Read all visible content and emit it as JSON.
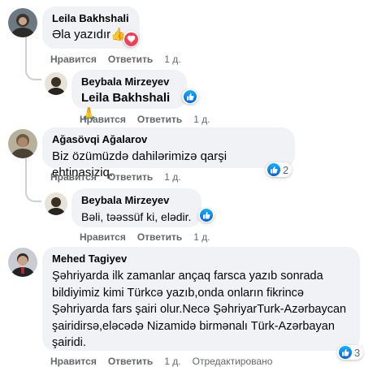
{
  "comments": [
    {
      "author": "Leila Bakhshali",
      "text": "Əla yazıdır",
      "emoji": "👍",
      "actions": {
        "like": "Нравится",
        "reply": "Ответить",
        "time": "1 д."
      }
    },
    {
      "author": "Beybala Mirzeyev",
      "mention": "Leila Bakhshali",
      "emoji": "🙏",
      "actions": {
        "like": "Нравится",
        "reply": "Ответить",
        "time": "1 д."
      }
    },
    {
      "author": "Ağasövqi Ağalarov",
      "text": "Biz özümüzdə dahilərimizə qarşi ehtinasiziq.",
      "reaction_count": "2",
      "actions": {
        "like": "Нравится",
        "reply": "Ответить",
        "time": "1 д."
      }
    },
    {
      "author": "Beybala Mirzeyev",
      "text": "Bəli, təəssüf ki, elədir.",
      "actions": {
        "like": "Нравится",
        "reply": "Ответить",
        "time": "1 д."
      }
    },
    {
      "author": "Mehed Tagiyev",
      "lines": [
        "Şəhriyarda ilk zamanlar ançaq farsca yazıb sonrada",
        "bildiyimiz kimi Türkcə yazıb,onda onların fikrincə",
        "Şəhriyarda fars şairi olur.Necə ŞəhriyarTurk-Azərbaycan",
        "şairidirsə,eləcədə Nizamidə birmənalı Türk-Azərbayan",
        "şairidi."
      ],
      "reaction_count": "3",
      "actions": {
        "like": "Нравится",
        "reply": "Ответить",
        "time": "1 д.",
        "edited": "Отредактировано"
      }
    }
  ],
  "colors": {
    "bubble": "#f0f2f5",
    "like_blue": "#1877f2",
    "love_red": "#f33e58",
    "meta": "#65676b"
  }
}
